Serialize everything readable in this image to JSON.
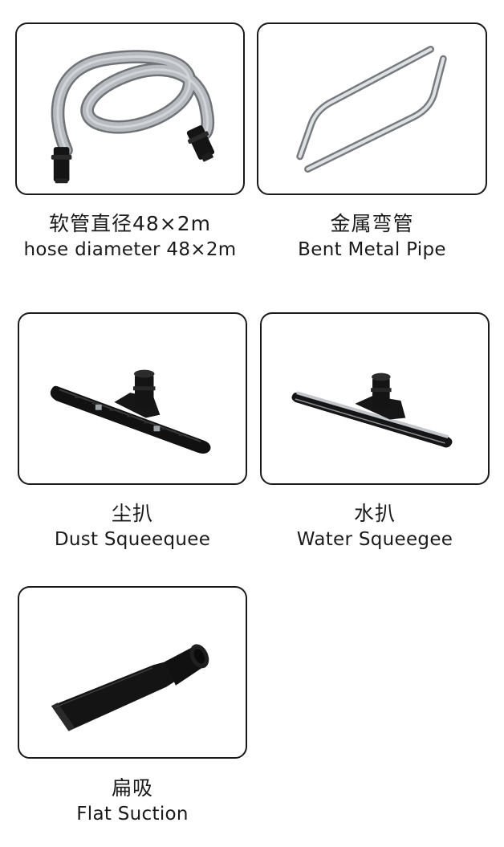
{
  "accessories": [
    {
      "name_zh": "软管直径48×2m",
      "name_en": "hose diameter 48×2m",
      "image_icon": "hose-icon"
    },
    {
      "name_zh": "金属弯管",
      "name_en": "Bent Metal Pipe",
      "image_icon": "bent-pipe-icon"
    },
    {
      "name_zh": "尘扒",
      "name_en": "Dust Squeequee",
      "image_icon": "dust-squeegee-icon"
    },
    {
      "name_zh": "水扒",
      "name_en": "Water Squeegee",
      "image_icon": "water-squeegee-icon"
    },
    {
      "name_zh": "扁吸",
      "name_en": "Flat Suction",
      "image_icon": "flat-suction-icon"
    }
  ],
  "colors": {
    "border": "#1a1a1a",
    "text": "#1a1a1a",
    "hose": "#9a9ea3",
    "metal": "#c7cbd0",
    "plastic": "#151515"
  }
}
